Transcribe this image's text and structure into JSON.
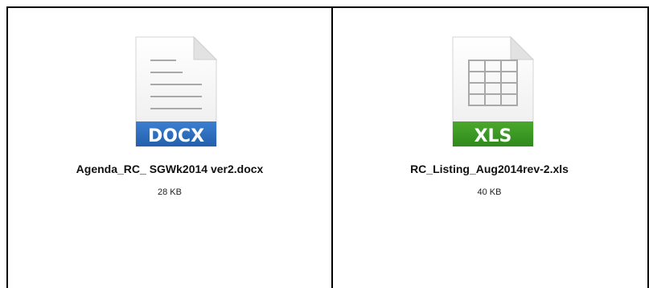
{
  "attachments": [
    {
      "name": "Agenda_RC_ SGWk2014 ver2.docx",
      "size": "28 KB",
      "type_label": "DOCX",
      "icon": "docx-file-icon",
      "accent": "#2f6fbf"
    },
    {
      "name": "RC_Listing_Aug2014rev-2.xls",
      "size": "40 KB",
      "type_label": "XLS",
      "icon": "xls-file-icon",
      "accent": "#3f9a25"
    }
  ]
}
